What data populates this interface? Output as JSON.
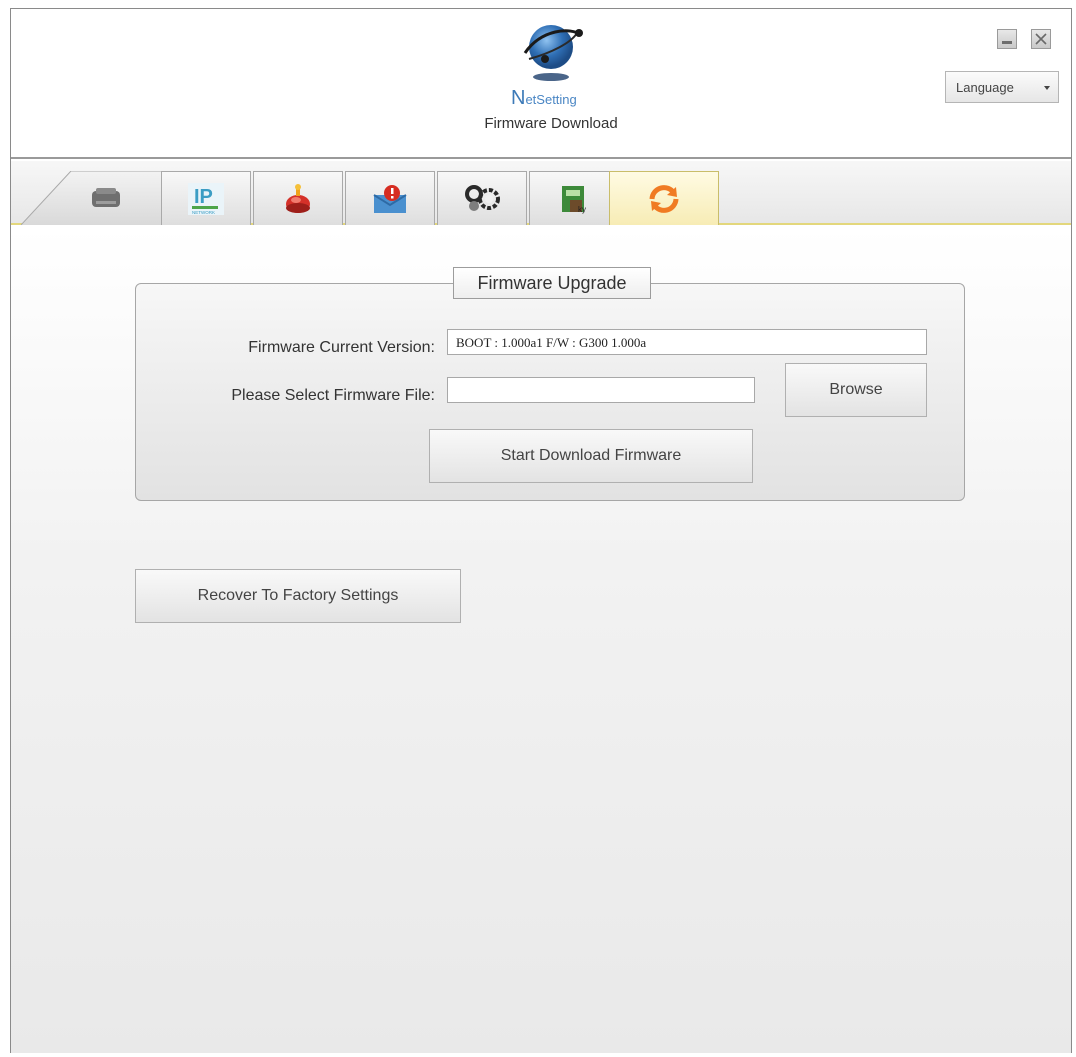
{
  "header": {
    "logo_text_n": "N",
    "logo_text_rest": "etSetting",
    "subtitle": "Firmware Download",
    "language_label": "Language"
  },
  "tabs": [
    {
      "icon": "printer-icon"
    },
    {
      "icon": "ip-network-icon",
      "text": "IP",
      "subtext": "NETWORK"
    },
    {
      "icon": "alarm-bell-icon"
    },
    {
      "icon": "mail-alert-icon"
    },
    {
      "icon": "gears-icon"
    },
    {
      "icon": "key-security-icon"
    },
    {
      "icon": "refresh-icon",
      "active": true
    }
  ],
  "firmware_upgrade": {
    "title": "Firmware Upgrade",
    "current_version_label": "Firmware Current Version:",
    "current_version_value": "BOOT : 1.000a1 F/W : G300 1.000a",
    "select_file_label": "Please Select Firmware File:",
    "select_file_value": "",
    "browse_label": "Browse",
    "start_download_label": "Start Download Firmware"
  },
  "recover_label": "Recover To Factory  Settings",
  "colors": {
    "active_tab": "#f7ecb5",
    "tab_underline": "#e3d77c",
    "logo_blue": "#3d7ab8",
    "refresh_orange": "#f07b23"
  }
}
